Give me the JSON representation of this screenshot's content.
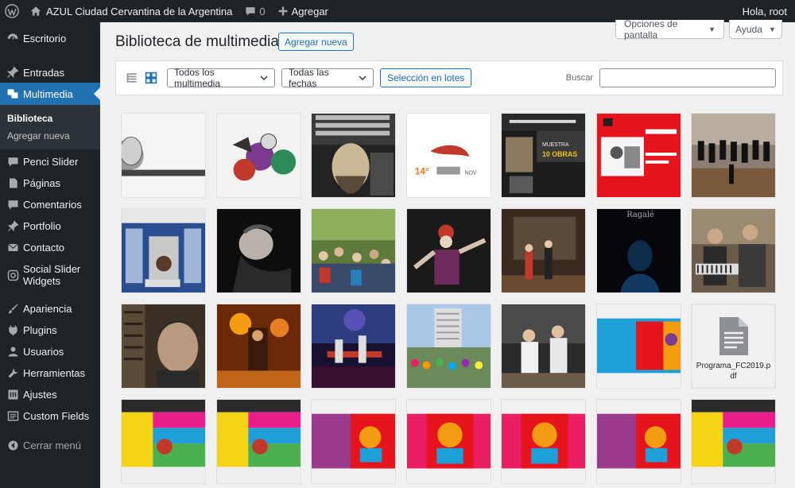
{
  "admin_bar": {
    "site_name": "AZUL Ciudad Cervantina de la Argentina",
    "comments_count": "0",
    "new_label": "Agregar",
    "howdy": "Hola, root"
  },
  "sidebar": {
    "items": [
      {
        "label": "Escritorio",
        "icon": "dashboard-icon"
      },
      {
        "label": "Entradas",
        "icon": "pin-icon"
      },
      {
        "label": "Multimedia",
        "icon": "media-icon"
      },
      {
        "label": "Penci Slider",
        "icon": "comment-icon"
      },
      {
        "label": "Páginas",
        "icon": "page-icon"
      },
      {
        "label": "Comentarios",
        "icon": "comment-icon"
      },
      {
        "label": "Portfolio",
        "icon": "pin-icon"
      },
      {
        "label": "Contacto",
        "icon": "mail-icon"
      },
      {
        "label": "Social Slider Widgets",
        "icon": "camera-icon"
      },
      {
        "label": "Apariencia",
        "icon": "brush-icon"
      },
      {
        "label": "Plugins",
        "icon": "plugin-icon"
      },
      {
        "label": "Usuarios",
        "icon": "user-icon"
      },
      {
        "label": "Herramientas",
        "icon": "wrench-icon"
      },
      {
        "label": "Ajustes",
        "icon": "settings-icon"
      },
      {
        "label": "Custom Fields",
        "icon": "fields-icon"
      }
    ],
    "submenu": [
      "Biblioteca",
      "Agregar nueva"
    ],
    "collapse": "Cerrar menú"
  },
  "screen_meta": {
    "options": "Opciones de pantalla",
    "help": "Ayuda"
  },
  "page": {
    "title": "Biblioteca de multimedia",
    "add_new": "Agregar nueva"
  },
  "toolbar": {
    "filter_type": "Todos los multimedia",
    "filter_date": "Todas las fechas",
    "bulk_select": "Selección en lotes",
    "search_label": "Buscar"
  },
  "media": {
    "file_name": "Programa_FC2019.pdf"
  }
}
